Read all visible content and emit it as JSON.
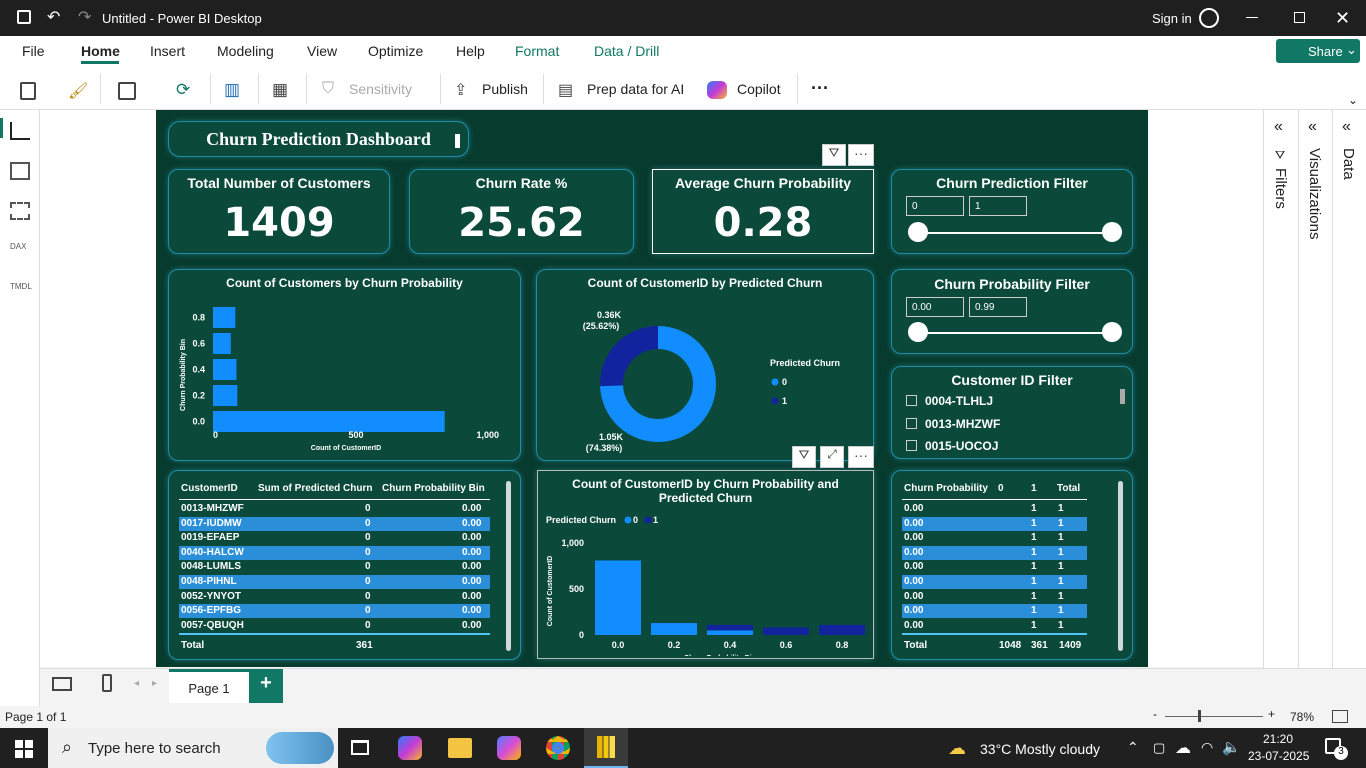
{
  "window": {
    "title": "Untitled - Power BI Desktop",
    "sign_in": "Sign in"
  },
  "menu": {
    "file": "File",
    "home": "Home",
    "insert": "Insert",
    "modeling": "Modeling",
    "view": "View",
    "optimize": "Optimize",
    "help": "Help",
    "format": "Format",
    "data_drill": "Data / Drill",
    "share": "Share"
  },
  "ribbon": {
    "sensitivity": "Sensitivity",
    "publish": "Publish",
    "prep": "Prep data for AI",
    "copilot": "Copilot",
    "more": "···"
  },
  "dashboard": {
    "title": "Churn Prediction Dashboard",
    "kpis": [
      {
        "label": "Total Number of Customers",
        "value": "1409"
      },
      {
        "label": "Churn Rate %",
        "value": "25.62"
      },
      {
        "label": "Average Churn Probability",
        "value": "0.28"
      }
    ],
    "churn_filter": {
      "title": "Churn Prediction Filter",
      "min": "0",
      "max": "1"
    },
    "prob_filter": {
      "title": "Churn Probability Filter",
      "min": "0.00",
      "max": "0.99"
    },
    "id_filter": {
      "title": "Customer ID Filter",
      "items": [
        "0004-TLHLJ",
        "0013-MHZWF",
        "0015-UOCOJ"
      ]
    },
    "table1": {
      "headers": [
        "CustomerID",
        "Sum of Predicted Churn",
        "Churn Probability Bin"
      ],
      "rows": [
        [
          "0013-MHZWF",
          "0",
          "0.00"
        ],
        [
          "0017-IUDMW",
          "0",
          "0.00"
        ],
        [
          "0019-EFAEP",
          "0",
          "0.00"
        ],
        [
          "0040-HALCW",
          "0",
          "0.00"
        ],
        [
          "0048-LUMLS",
          "0",
          "0.00"
        ],
        [
          "0048-PIHNL",
          "0",
          "0.00"
        ],
        [
          "0052-YNYOT",
          "0",
          "0.00"
        ],
        [
          "0056-EPFBG",
          "0",
          "0.00"
        ],
        [
          "0057-QBUQH",
          "0",
          "0.00"
        ]
      ],
      "total": [
        "Total",
        "361"
      ]
    },
    "table2": {
      "headers": [
        "Churn Probability",
        "0",
        "1",
        "Total"
      ],
      "rows": [
        [
          "0.00",
          "",
          "1",
          "1"
        ],
        [
          "0.00",
          "",
          "1",
          "1"
        ],
        [
          "0.00",
          "",
          "1",
          "1"
        ],
        [
          "0.00",
          "",
          "1",
          "1"
        ],
        [
          "0.00",
          "",
          "1",
          "1"
        ],
        [
          "0.00",
          "",
          "1",
          "1"
        ],
        [
          "0.00",
          "",
          "1",
          "1"
        ],
        [
          "0.00",
          "",
          "1",
          "1"
        ],
        [
          "0.00",
          "",
          "1",
          "1"
        ]
      ],
      "total": [
        "Total",
        "1048",
        "361",
        "1409"
      ]
    }
  },
  "chart_data": [
    {
      "type": "bar",
      "orientation": "horizontal",
      "title": "Count of Customers by Churn Probability",
      "xlabel": "Count of CustomerID",
      "ylabel": "Churn Probability Bin",
      "categories": [
        "0.8",
        "0.6",
        "0.4",
        "0.2",
        "0.0"
      ],
      "values": [
        78,
        62,
        82,
        85,
        810
      ],
      "xlim": [
        0,
        1000
      ],
      "xticks": [
        "0",
        "500",
        "1,000"
      ]
    },
    {
      "type": "pie",
      "title": "Count of CustomerID by Predicted Churn",
      "legend_title": "Predicted Churn",
      "legend_position": "right",
      "categories": [
        "0",
        "1"
      ],
      "values": [
        1048,
        361
      ],
      "labels": [
        "1.05K\n(74.38%)",
        "0.36K\n(25.62%)"
      ],
      "colors": [
        "#118dff",
        "#12239e"
      ]
    },
    {
      "type": "bar",
      "stacked": true,
      "title": "Count of CustomerID by Churn Probability and Predicted Churn",
      "xlabel": "Churn Probability Bin",
      "ylabel": "Count of CustomerID",
      "legend_title": "Predicted Churn",
      "legend_position": "top-left",
      "categories": [
        "0.0",
        "0.2",
        "0.4",
        "0.6",
        "0.8"
      ],
      "series": [
        {
          "name": "0",
          "values": [
            810,
            130,
            50,
            0,
            0
          ],
          "color": "#118dff"
        },
        {
          "name": "1",
          "values": [
            0,
            0,
            60,
            82,
            110
          ],
          "color": "#12239e"
        }
      ],
      "ylim": [
        0,
        1000
      ],
      "yticks": [
        "0",
        "500",
        "1,000"
      ]
    }
  ],
  "panels": {
    "filters": "Filters",
    "visualizations": "Visualizations",
    "data": "Data"
  },
  "pages": {
    "page1": "Page 1",
    "add": "+"
  },
  "status": {
    "page_info": "Page 1 of 1",
    "zoom": "78%"
  },
  "taskbar": {
    "search": "Type here to search",
    "weather": "33°C  Mostly cloudy",
    "time": "21:20",
    "date": "23-07-2025",
    "badge": "3"
  }
}
